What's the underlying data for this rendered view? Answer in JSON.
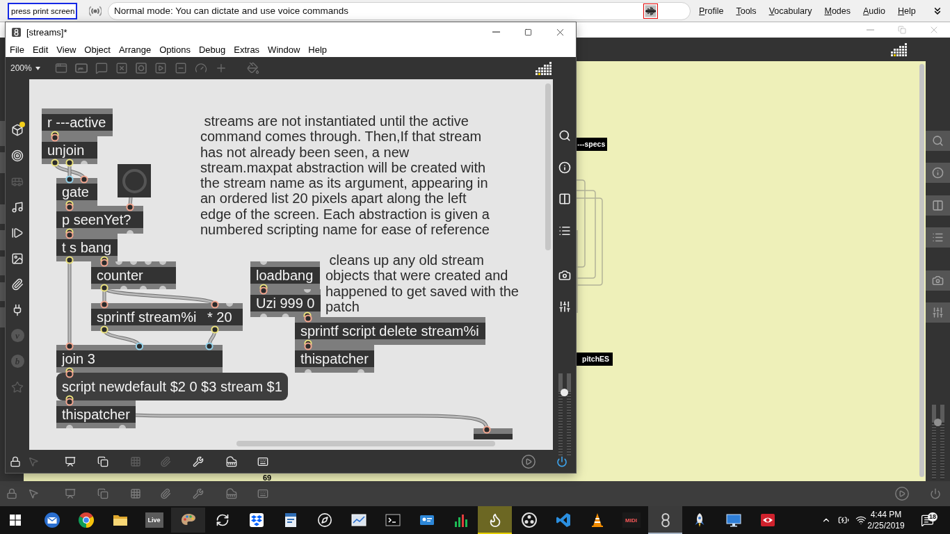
{
  "dictation_bar": {
    "status": "press print screen",
    "mode": "Normal mode: You can dictate and use voice commands",
    "menu": [
      "Profile",
      "Tools",
      "Vocabulary",
      "Modes",
      "Audio",
      "Help"
    ]
  },
  "back_window": {
    "objects": [
      {
        "text": "---specs"
      },
      {
        "text": "pitchES"
      }
    ],
    "number": "69",
    "gain": {
      "level": 0.77
    }
  },
  "window": {
    "title": "[streams]*",
    "menu": [
      "File",
      "Edit",
      "View",
      "Object",
      "Arrange",
      "Options",
      "Debug",
      "Extras",
      "Window",
      "Help"
    ],
    "zoom": "200%",
    "left_sidebar": [
      {
        "disabled": false,
        "badge": true
      },
      {
        "disabled": false,
        "badge": false
      },
      {
        "disabled": true,
        "badge": false
      },
      {
        "disabled": false,
        "badge": false
      },
      {
        "disabled": false,
        "badge": false
      },
      {
        "disabled": false,
        "badge": false
      },
      {
        "disabled": false,
        "badge": false
      },
      {
        "disabled": false,
        "badge": false
      },
      {
        "disabled": true,
        "badge": false,
        "label": "v"
      },
      {
        "disabled": true,
        "badge": false,
        "label": "b"
      },
      {
        "disabled": true,
        "badge": false
      }
    ],
    "patch": {
      "objects": [
        {
          "kind": "object",
          "text": "r ---active",
          "outlets": [
            {
              "connected": true
            }
          ]
        },
        {
          "kind": "comment",
          "text": " streams are not instantiated until the active command comes through. Then,If that stream has not already been seen, a new stream.maxpat abstraction will be created with the stream name as its argument, appearing in an ordered list 20 pixels apart along the left edge of the screen. Each abstraction is given a numbered scripting name for ease of reference"
        },
        {
          "kind": "object",
          "text": "unjoin",
          "inlets": [
            {
              "connected": true,
              "cold": false
            }
          ],
          "outlets": [
            {
              "connected": true
            },
            {
              "connected": true
            },
            {
              "connected": false
            }
          ]
        },
        {
          "kind": "button"
        },
        {
          "kind": "object",
          "text": "gate",
          "inlets": [
            {
              "connected": true,
              "cold": true
            },
            {
              "connected": true,
              "cold": false
            }
          ],
          "outlets": [
            {
              "connected": true
            }
          ]
        },
        {
          "kind": "object",
          "text": "p seenYet?",
          "inlets": [
            {
              "connected": true,
              "cold": false
            },
            {
              "connected": true,
              "cold": false
            }
          ],
          "outlets": [
            {
              "connected": true
            },
            {
              "connected": false
            }
          ]
        },
        {
          "kind": "object",
          "text": "t s bang",
          "inlets": [
            {
              "connected": true,
              "cold": false
            }
          ],
          "outlets": [
            {
              "connected": true
            },
            {
              "connected": true
            }
          ]
        },
        {
          "kind": "comment",
          "text": " cleans up any old stream objects that were created and happened to get saved with the patch"
        },
        {
          "kind": "object",
          "text": "counter",
          "inlets": [
            {
              "connected": true,
              "cold": false
            },
            {
              "connected": false
            },
            {
              "connected": false
            },
            {
              "connected": false
            },
            {
              "connected": false
            }
          ],
          "outlets": [
            {
              "connected": true
            },
            {
              "connected": false
            },
            {
              "connected": false
            },
            {
              "connected": false
            }
          ]
        },
        {
          "kind": "object",
          "text": "loadbang",
          "inlets": [
            {
              "connected": false
            }
          ],
          "outlets": [
            {
              "connected": true
            }
          ]
        },
        {
          "kind": "object",
          "text": "Uzi 999 0",
          "inlets": [
            {
              "connected": true,
              "cold": false
            },
            {
              "connected": false
            }
          ],
          "outlets": [
            {
              "connected": false
            },
            {
              "connected": false
            },
            {
              "connected": true
            }
          ]
        },
        {
          "kind": "object",
          "text": "sprintf stream%i",
          "inlets": [
            {
              "connected": true,
              "cold": false
            }
          ],
          "outlets": [
            {
              "connected": true
            }
          ]
        },
        {
          "kind": "object",
          "text": "* 20",
          "inlets": [
            {
              "connected": true,
              "cold": false
            },
            {
              "connected": false
            }
          ],
          "outlets": [
            {
              "connected": true
            }
          ]
        },
        {
          "kind": "object",
          "text": "sprintf script delete stream%i",
          "inlets": [
            {
              "connected": true,
              "cold": false
            }
          ],
          "outlets": [
            {
              "connected": true
            }
          ]
        },
        {
          "kind": "object",
          "text": "join 3",
          "inlets": [
            {
              "connected": true,
              "cold": false
            },
            {
              "connected": true,
              "cold": true
            },
            {
              "connected": true,
              "cold": true
            }
          ],
          "outlets": [
            {
              "connected": true
            }
          ]
        },
        {
          "kind": "object",
          "text": "thispatcher",
          "inlets": [
            {
              "connected": true,
              "cold": false
            }
          ],
          "outlets": [
            {
              "connected": false
            },
            {
              "connected": false
            }
          ]
        },
        {
          "kind": "message",
          "text": "script newdefault $2 0 $3 stream $1",
          "inlets": [
            {
              "connected": true,
              "cold": false
            }
          ],
          "outlets": [
            {
              "connected": true
            }
          ]
        },
        {
          "kind": "object",
          "text": "thispatcher",
          "inlets": [
            {
              "connected": true,
              "cold": false
            }
          ],
          "outlets": [
            {
              "connected": false
            },
            {
              "connected": false
            }
          ]
        },
        {
          "kind": "object",
          "inlets": [
            {
              "connected": true,
              "cold": false
            }
          ]
        }
      ]
    },
    "gain": {
      "level": 0.77
    },
    "bottom_toolbar": [
      {
        "disabled": false
      },
      {
        "disabled": true
      },
      {
        "disabled": false
      },
      {
        "disabled": false
      },
      {
        "disabled": true
      },
      {
        "disabled": true
      },
      {
        "disabled": false
      },
      {
        "disabled": false
      },
      {
        "disabled": false
      }
    ],
    "audio_on": true
  },
  "taskbar": {
    "apps": [
      {
        "selected": false,
        "hovered": false,
        "flashing": false
      },
      {
        "selected": false,
        "hovered": false,
        "flashing": false
      },
      {
        "selected": false,
        "hovered": false,
        "flashing": false
      },
      {
        "selected": false,
        "hovered": false,
        "flashing": false,
        "label": "Live"
      },
      {
        "selected": false,
        "hovered": true,
        "flashing": false
      },
      {
        "selected": false,
        "hovered": false,
        "flashing": false
      },
      {
        "selected": false,
        "hovered": false,
        "flashing": false
      },
      {
        "selected": false,
        "hovered": false,
        "flashing": false
      },
      {
        "selected": false,
        "hovered": false,
        "flashing": false
      },
      {
        "selected": false,
        "hovered": false,
        "flashing": false
      },
      {
        "selected": false,
        "hovered": false,
        "flashing": false
      },
      {
        "selected": false,
        "hovered": false,
        "flashing": false
      },
      {
        "selected": false,
        "hovered": false,
        "flashing": false
      },
      {
        "selected": false,
        "hovered": false,
        "flashing": true
      },
      {
        "selected": false,
        "hovered": false,
        "flashing": false
      },
      {
        "selected": false,
        "hovered": false,
        "flashing": false
      },
      {
        "selected": false,
        "hovered": false,
        "flashing": false
      },
      {
        "selected": false,
        "hovered": false,
        "flashing": false,
        "label": "MIDI"
      },
      {
        "selected": true,
        "hovered": false,
        "flashing": false
      },
      {
        "selected": false,
        "hovered": false,
        "flashing": false
      },
      {
        "selected": false,
        "hovered": false,
        "flashing": false
      },
      {
        "selected": false,
        "hovered": false,
        "flashing": false
      }
    ],
    "time": "4:44 PM",
    "date": "2/25/2019",
    "notifications": "18"
  }
}
